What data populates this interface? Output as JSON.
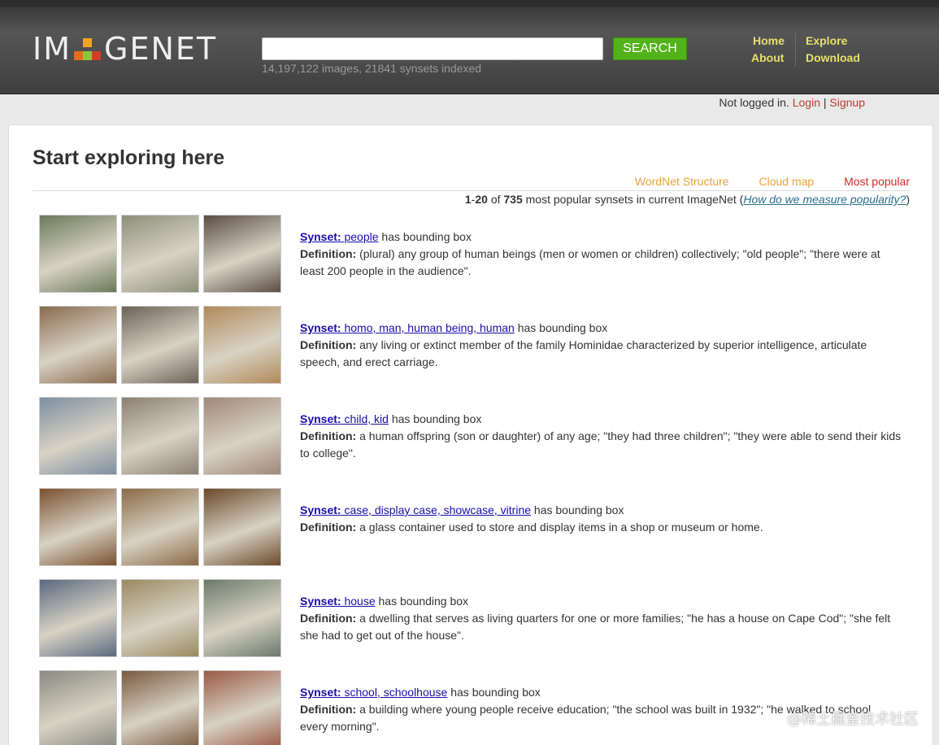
{
  "header": {
    "logo_left": "IM",
    "logo_right": "GENET",
    "search_button": "SEARCH",
    "search_value": "",
    "index_info": "14,197,122 images, 21841 synsets indexed",
    "nav": {
      "home": "Home",
      "about": "About",
      "explore": "Explore",
      "download": "Download"
    },
    "logo_colors": [
      "#f5a31a",
      "#e86b1a",
      "#8bc53f",
      "#d63a2a"
    ]
  },
  "login": {
    "status": "Not logged in.",
    "login": "Login",
    "separator": "|",
    "signup": "Signup"
  },
  "main": {
    "title": "Start exploring here",
    "tabs": {
      "wordnet": "WordNet Structure",
      "cloud": "Cloud map",
      "popular": "Most popular"
    },
    "summary": {
      "range_start": "1",
      "range_sep": "-",
      "range_end": "20",
      "of": "of",
      "total": "735",
      "text": "most popular synsets in current ImageNet",
      "open_paren": "(",
      "link": "How do we measure popularity?",
      "close_paren": ")"
    },
    "synset_label": "Synset:",
    "definition_label": "Definition:",
    "bbox_text": "has bounding box",
    "rows": [
      {
        "names": [
          "people"
        ],
        "definition": "(plural) any group of human beings (men or women or children) collectively; \"old people\"; \"there were at least 200 people in the audience\"."
      },
      {
        "names": [
          "homo",
          "man",
          "human being",
          "human"
        ],
        "definition": "any living or extinct member of the family Hominidae characterized by superior intelligence, articulate speech, and erect carriage."
      },
      {
        "names": [
          "child",
          "kid"
        ],
        "definition": "a human offspring (son or daughter) of any age; \"they had three children\"; \"they were able to send their kids to college\"."
      },
      {
        "names": [
          "case",
          "display case",
          "showcase",
          "vitrine"
        ],
        "definition": "a glass container used to store and display items in a shop or museum or home."
      },
      {
        "names": [
          "house"
        ],
        "definition": "a dwelling that serves as living quarters for one or more families; \"he has a house on Cape Cod\"; \"she felt she had to get out of the house\"."
      },
      {
        "names": [
          "school",
          "schoolhouse"
        ],
        "definition": "a building where young people receive education; \"the school was built in 1932\"; \"he walked to school every morning\"."
      }
    ]
  },
  "watermark": "@稀土掘金技术社区"
}
